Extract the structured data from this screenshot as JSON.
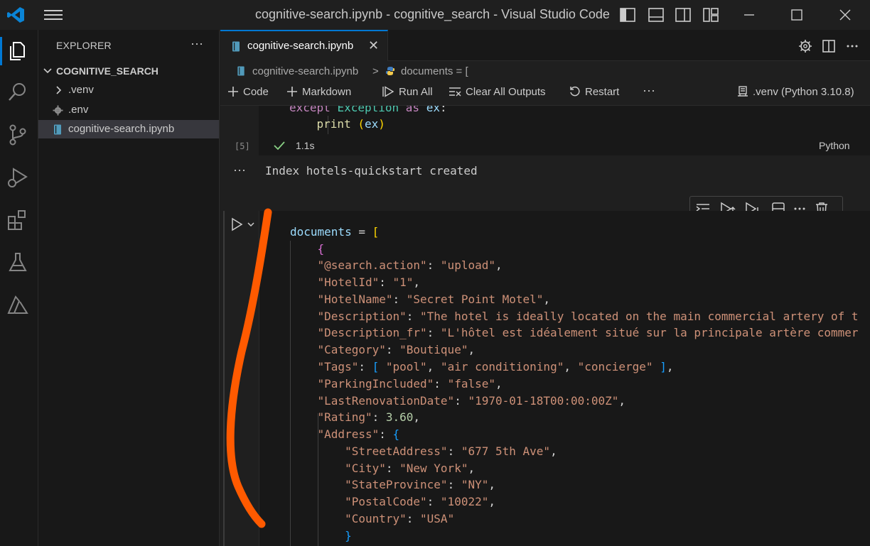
{
  "window": {
    "title": "cognitive-search.ipynb - cognitive_search - Visual Studio Code"
  },
  "sidebar": {
    "header": "EXPLORER",
    "more": "···",
    "folder": "COGNITIVE_SEARCH",
    "items": [
      {
        "label": ".venv",
        "icon": "chevron-right-icon"
      },
      {
        "label": ".env",
        "icon": "gear-icon"
      },
      {
        "label": "cognitive-search.ipynb",
        "icon": "notebook-icon"
      }
    ]
  },
  "editor": {
    "tab": {
      "label": "cognitive-search.ipynb",
      "close": "✕"
    },
    "breadcrumb": {
      "file": "cognitive-search.ipynb",
      "separator": ">",
      "symbol": "documents = ["
    },
    "toolbar": {
      "code": "Code",
      "markdown": "Markdown",
      "run_all": "Run All",
      "clear_outputs": "Clear All Outputs",
      "restart": "Restart",
      "more": "···",
      "kernel": ".venv (Python 3.10.8)"
    }
  },
  "cells": {
    "prev": {
      "lines": [
        "except Exception as ex:",
        "print (ex)"
      ],
      "execution_count": "[5]",
      "duration": "1.1s",
      "language": "Python",
      "output_dots": "···",
      "output": "Index hotels-quickstart created"
    },
    "current": {
      "line1": {
        "var": "documents",
        "op": " = ",
        "br": "["
      },
      "open_brace": "{",
      "entries": [
        {
          "key": "\"@search.action\"",
          "val": "\"upload\"",
          "trail": ","
        },
        {
          "key": "\"HotelId\"",
          "val": "\"1\"",
          "trail": ","
        },
        {
          "key": "\"HotelName\"",
          "val": "\"Secret Point Motel\"",
          "trail": ","
        },
        {
          "key": "\"Description\"",
          "val": "\"The hotel is ideally located on the main commercial artery of t",
          "trail": ""
        },
        {
          "key": "\"Description_fr\"",
          "val": "\"L'hôtel est idéalement situé sur la principale artère commer",
          "trail": ""
        },
        {
          "key": "\"Category\"",
          "val": "\"Boutique\"",
          "trail": ","
        }
      ],
      "tags": {
        "key": "\"Tags\"",
        "open": "[",
        "items": [
          "\"pool\"",
          "\"air conditioning\"",
          "\"concierge\""
        ],
        "close": "]"
      },
      "entries2": [
        {
          "key": "\"ParkingIncluded\"",
          "val": "\"false\"",
          "trail": ","
        },
        {
          "key": "\"LastRenovationDate\"",
          "val": "\"1970-01-18T00:00:00Z\"",
          "trail": ","
        }
      ],
      "rating": {
        "key": "\"Rating\"",
        "val": "3.60"
      },
      "address": {
        "key": "\"Address\"",
        "open": "{"
      },
      "address_entries": [
        {
          "key": "\"StreetAddress\"",
          "val": "\"677 5th Ave\"",
          "trail": ","
        },
        {
          "key": "\"City\"",
          "val": "\"New York\"",
          "trail": ","
        },
        {
          "key": "\"StateProvince\"",
          "val": "\"NY\"",
          "trail": ","
        },
        {
          "key": "\"PostalCode\"",
          "val": "\"10022\"",
          "trail": ","
        },
        {
          "key": "\"Country\"",
          "val": "\"USA\"",
          "trail": ""
        }
      ],
      "address_close": "}"
    }
  },
  "colors": {
    "accent": "#0078d4",
    "annotation": "#ff5a00"
  }
}
